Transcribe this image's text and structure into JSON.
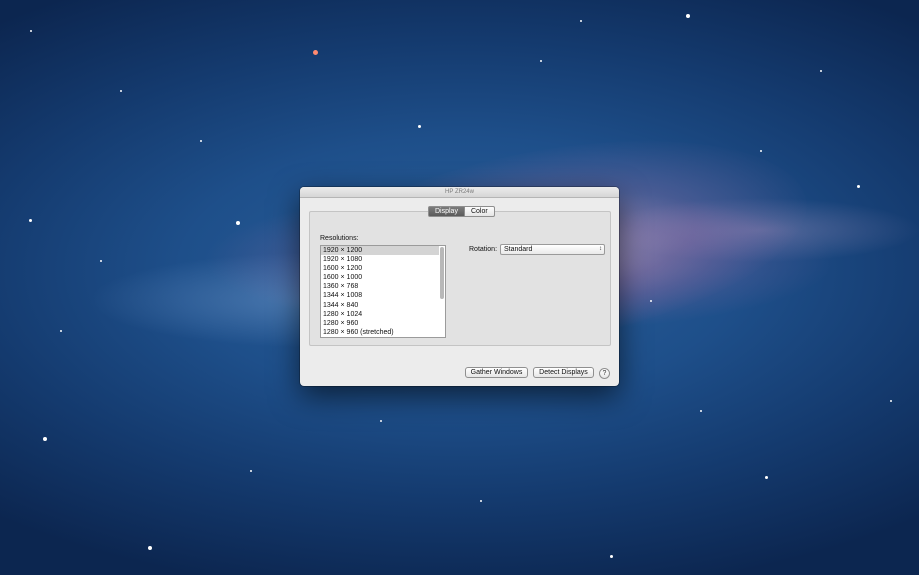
{
  "window": {
    "title": "HP ZR24w"
  },
  "tabs": [
    {
      "label": "Display",
      "selected": true
    },
    {
      "label": "Color",
      "selected": false
    }
  ],
  "resolutions": {
    "label": "Resolutions:",
    "selected_index": 0,
    "items": [
      "1920 × 1200",
      "1920 × 1080",
      "1600 × 1200",
      "1600 × 1000",
      "1360 × 768",
      "1344 × 1008",
      "1344 × 840",
      "1280 × 1024",
      "1280 × 960",
      "1280 × 960 (stretched)"
    ]
  },
  "rotation": {
    "label": "Rotation:",
    "value": "Standard"
  },
  "buttons": {
    "gather_windows": "Gather Windows",
    "detect_displays": "Detect Displays",
    "help": "?"
  },
  "icons": {
    "popup_arrows": "up-down-chevron-icon",
    "help": "help-icon"
  },
  "colors": {
    "desktop_background": "#1e4f8a",
    "window_background": "#ececec",
    "selected_tab": "#6a6a6a"
  }
}
